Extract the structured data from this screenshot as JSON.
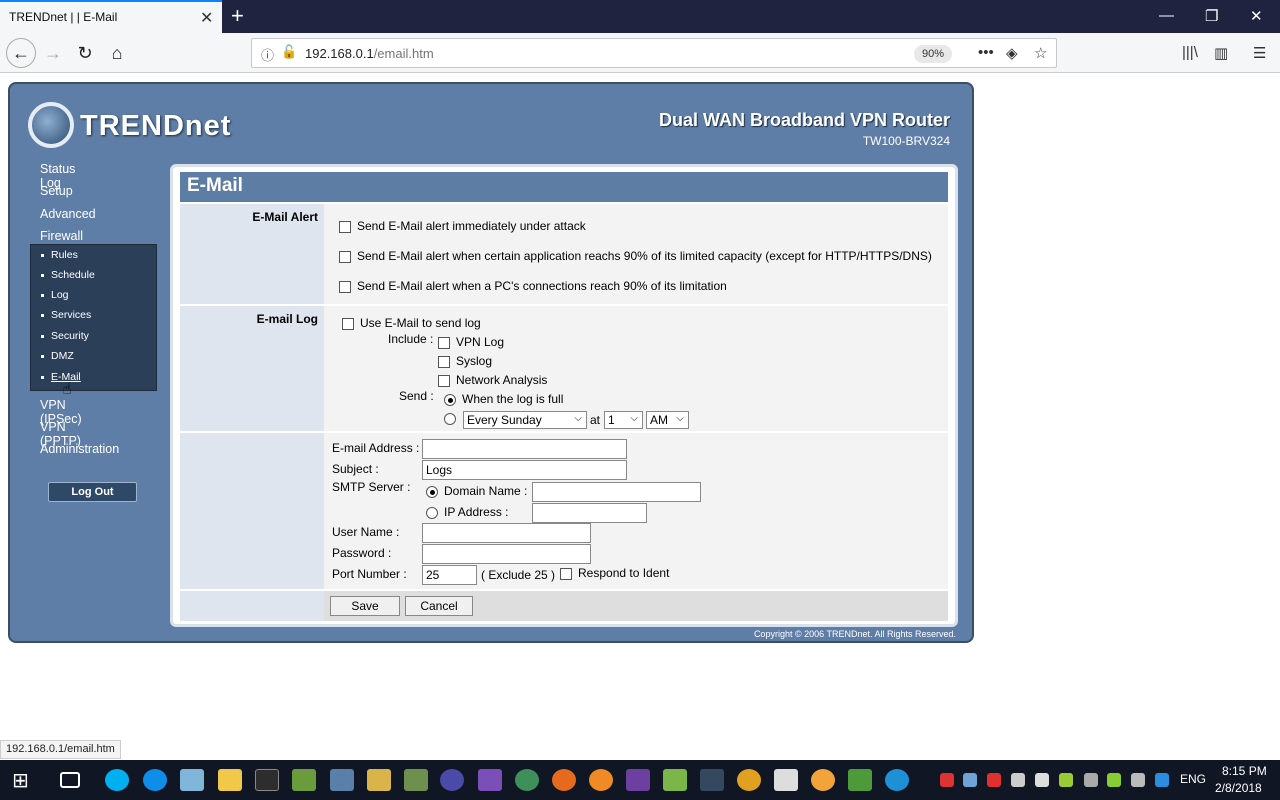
{
  "browser": {
    "tab_title": "TRENDnet | | E-Mail",
    "tab_close": "✕",
    "new_tab": "+",
    "url_host": "192.168.0.1",
    "url_path": "/email.htm",
    "zoom": "90%",
    "status_url": "192.168.0.1/email.htm"
  },
  "router": {
    "logo": "TRENDnet",
    "product_name": "Dual WAN Broadband VPN Router",
    "product_model": "TW100-BRV324",
    "menu": [
      "Status Log",
      "Setup",
      "Advanced",
      "Firewall"
    ],
    "submenu": [
      "Rules",
      "Schedule",
      "Log",
      "Services",
      "Security",
      "DMZ",
      "E-Mail"
    ],
    "menu_after": [
      "VPN (IPSec)",
      "VPN (PPTP)",
      "Administration"
    ],
    "logout_label": "Log Out",
    "copyright": "Copyright © 2006 TRENDnet. All Rights Reserved."
  },
  "page": {
    "title": "E-Mail",
    "alert": {
      "label": "E-Mail Alert",
      "options": [
        "Send E-Mail alert immediately under attack",
        "Send E-Mail alert when certain application reachs 90% of its limited capacity (except for HTTP/HTTPS/DNS)",
        "Send E-Mail alert when a PC's connections reach 90% of its limitation"
      ]
    },
    "log": {
      "label": "E-mail Log",
      "use_email": "Use E-Mail to send log",
      "include_label": "Include :",
      "include_options": [
        "VPN Log",
        "Syslog",
        "Network Analysis"
      ],
      "send_label": "Send :",
      "send_when_full": "When the log is full",
      "send_day": "Every Sunday",
      "at_label": "at",
      "send_hour": "1",
      "send_ampm": "AM"
    },
    "smtp": {
      "email_address_label": "E-mail Address :",
      "email_address_value": "",
      "subject_label": "Subject :",
      "subject_value": "Logs",
      "server_label": "SMTP Server :",
      "domain_name_label": "Domain Name :",
      "domain_name_value": "",
      "ip_address_label": "IP Address :",
      "ip_address_value": "",
      "username_label": "User Name :",
      "username_value": "",
      "password_label": "Password :",
      "password_value": "",
      "port_label": "Port Number :",
      "port_value": "25",
      "port_note": "( Exclude 25 )",
      "respond_ident": "Respond to Ident"
    },
    "buttons": {
      "save": "Save",
      "cancel": "Cancel"
    }
  },
  "taskbar": {
    "lang": "ENG",
    "time": "8:15 PM",
    "date": "2/8/2018"
  }
}
